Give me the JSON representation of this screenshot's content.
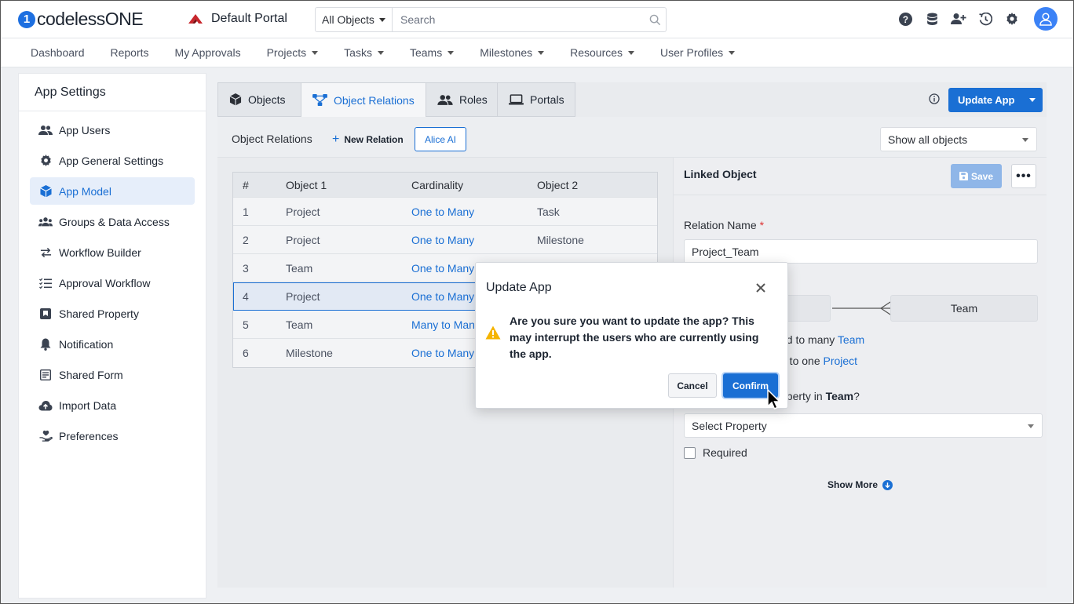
{
  "header": {
    "logo_text": "codelessONE",
    "logo_mark": "1",
    "portal_name": "Default Portal",
    "search_scope": "All Objects",
    "search_placeholder": "Search"
  },
  "nav": {
    "items": [
      {
        "label": "Dashboard",
        "dropdown": false
      },
      {
        "label": "Reports",
        "dropdown": false
      },
      {
        "label": "My Approvals",
        "dropdown": false
      },
      {
        "label": "Projects",
        "dropdown": true
      },
      {
        "label": "Tasks",
        "dropdown": true
      },
      {
        "label": "Teams",
        "dropdown": true
      },
      {
        "label": "Milestones",
        "dropdown": true
      },
      {
        "label": "Resources",
        "dropdown": true
      },
      {
        "label": "User Profiles",
        "dropdown": true
      }
    ]
  },
  "sidebar": {
    "title": "App Settings",
    "items": [
      {
        "label": "App Users",
        "icon": "users-icon"
      },
      {
        "label": "App General Settings",
        "icon": "gear-icon"
      },
      {
        "label": "App Model",
        "icon": "cube-icon",
        "active": true
      },
      {
        "label": "Groups & Data Access",
        "icon": "group-icon"
      },
      {
        "label": "Workflow Builder",
        "icon": "arrows-icon"
      },
      {
        "label": "Approval Workflow",
        "icon": "checklist-icon"
      },
      {
        "label": "Shared Property",
        "icon": "bookmark-box-icon"
      },
      {
        "label": "Notification",
        "icon": "bell-icon"
      },
      {
        "label": "Shared Form",
        "icon": "form-icon"
      },
      {
        "label": "Import Data",
        "icon": "cloud-upload-icon"
      },
      {
        "label": "Preferences",
        "icon": "hand-heart-icon"
      }
    ]
  },
  "tabs": [
    {
      "label": "Objects",
      "icon": "cube-icon"
    },
    {
      "label": "Object Relations",
      "icon": "relations-icon",
      "active": true
    },
    {
      "label": "Roles",
      "icon": "users-icon"
    },
    {
      "label": "Portals",
      "icon": "laptop-icon"
    }
  ],
  "toolbar": {
    "update_app_label": "Update App",
    "section_title": "Object Relations",
    "new_relation_label": "New Relation",
    "alice_label": "Alice AI",
    "filter_value": "Show all objects"
  },
  "table": {
    "headers": [
      "#",
      "Object 1",
      "Cardinality",
      "Object 2"
    ],
    "rows": [
      {
        "num": "1",
        "obj1": "Project",
        "card": "One to Many",
        "obj2": "Task"
      },
      {
        "num": "2",
        "obj1": "Project",
        "card": "One to Many",
        "obj2": "Milestone"
      },
      {
        "num": "3",
        "obj1": "Team",
        "card": "One to Many",
        "obj2": ""
      },
      {
        "num": "4",
        "obj1": "Project",
        "card": "One to Many",
        "obj2": "",
        "selected": true
      },
      {
        "num": "5",
        "obj1": "Team",
        "card": "Many to Many",
        "obj2": ""
      },
      {
        "num": "6",
        "obj1": "Milestone",
        "card": "One to Many",
        "obj2": ""
      }
    ]
  },
  "panel": {
    "title": "Linked Object",
    "save_label": "Save",
    "more_label": "•••",
    "relation_name_label": "Relation Name",
    "required_mark": "*",
    "relation_name_value": "Project_Team",
    "right_object": "Team",
    "desc1_prefix": "ed to many",
    "desc1_link": "Team",
    "desc2_prefix": "d to one",
    "desc2_link": "Project",
    "prop_question_prefix": "operty in",
    "prop_question_bold": "Team",
    "prop_question_suffix": "?",
    "select_placeholder": "Select Property",
    "required_label": "Required",
    "show_more_label": "Show More"
  },
  "modal": {
    "title": "Update App",
    "message": "Are you sure you want to update the app? This may interrupt the users who are currently using the app.",
    "cancel_label": "Cancel",
    "confirm_label": "Confirm"
  },
  "colors": {
    "primary": "#1a6fd4",
    "warning": "#f5b400",
    "required": "#d33333"
  }
}
